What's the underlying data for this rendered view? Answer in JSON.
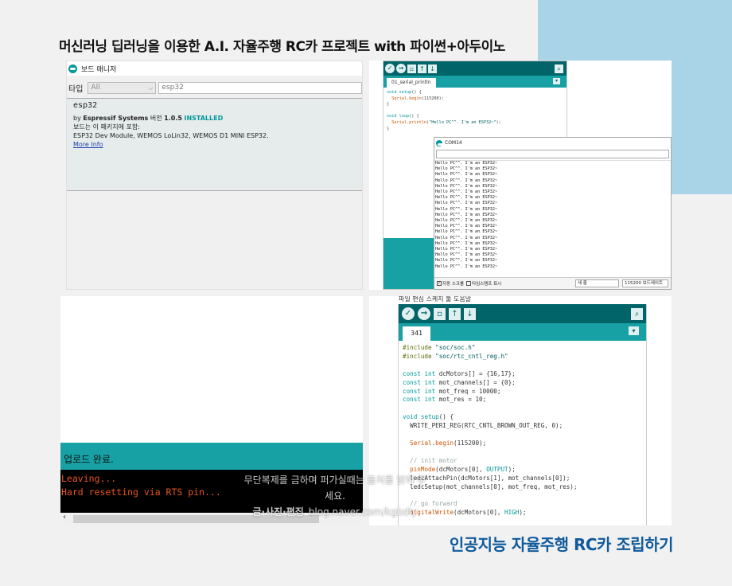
{
  "header": {
    "title": "머신러닝 딥러닝을 이용한 A.I. 자율주행 RC카 프로젝트 with 파이썬+아두이노"
  },
  "footer": {
    "title": "인공지능 자율주행 RC카 조립하기"
  },
  "board_manager": {
    "window_title": "보드 매니저",
    "type_label": "타입",
    "type_value": "All",
    "search_value": "esp32",
    "package_name": "esp32",
    "by_prefix": "by",
    "author": "Espressif Systems",
    "version_label": "버전",
    "version": "1.0.5",
    "installed": "INSTALLED",
    "included_label": "보드는 이 패키지에 포함:",
    "boards": "ESP32 Dev Module, WEMOS LoLin32, WEMOS D1 MINI ESP32.",
    "more_info": "More Info"
  },
  "serial_ide": {
    "tab": "01_serial_println",
    "code": [
      "void setup() {",
      "  Serial.begin(115200);",
      "}",
      "",
      "void loop() {",
      "  Serial.println(\"Hello PC^^. I'm an ESP32~\");",
      "}"
    ],
    "monitor_title": "COM14",
    "output_line": "Hello PC^^. I'm an ESP32~",
    "output_count": 19,
    "autoscroll_label": "자동 스크롤",
    "timestamp_label": "타임스탬프 표시",
    "line_ending": "새 줄",
    "baud": "115200 보드레이트"
  },
  "upload": {
    "status": "업로드 완료.",
    "console": [
      "Leaving...",
      "Hard resetting via RTS pin..."
    ]
  },
  "watermark": {
    "line1": "무단복제를 금하며 퍼가실때는 출처를 밝혀 주세요.",
    "bold": "글·사진·편집",
    "url": "blog.naver.com/kgbdiy"
  },
  "code_ide": {
    "menu": "파일  편집  스케치  툴  도움말",
    "tab": "341"
  },
  "colors": {
    "accent": "#17a1a5",
    "toolbar": "#006468",
    "title_blue": "#0f5a9c",
    "console_text": "#e8541f"
  }
}
